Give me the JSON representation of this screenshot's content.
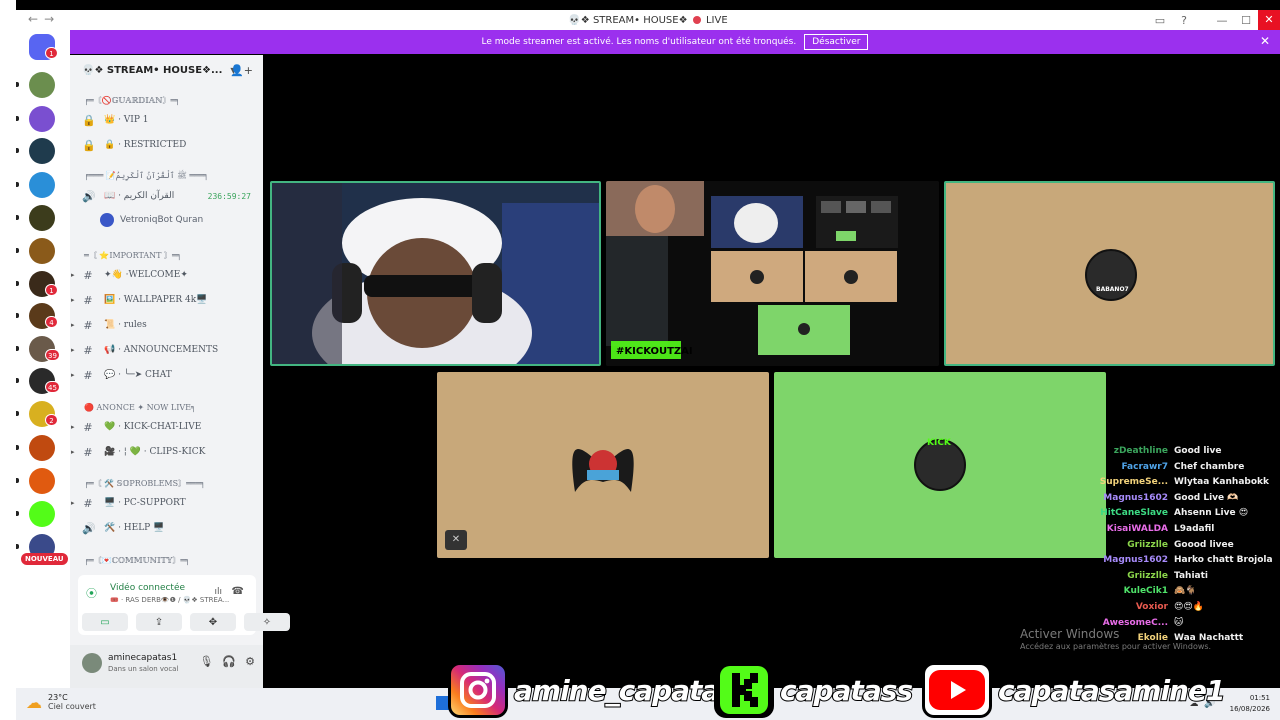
{
  "window": {
    "title_prefix": "💀❖ STREAM• HOUSE❖",
    "title_live": "LIVE",
    "nav_back": "←",
    "nav_forward": "→",
    "inbox_icon": "▭",
    "help_icon": "?",
    "minimize": "—",
    "maximize": "☐",
    "close": "✕"
  },
  "streamer_banner": {
    "text": "Le mode streamer est activé. Les noms d'utilisateur ont été tronqués.",
    "button": "Désactiver",
    "close": "✕"
  },
  "server_rail": {
    "items": [
      {
        "badge": "1",
        "color": "#5865f2"
      },
      {
        "badge": "",
        "color": "#6b8e4e"
      },
      {
        "badge": "",
        "color": "#7a4fd0"
      },
      {
        "badge": "",
        "color": "#1f3b4d"
      },
      {
        "badge": "",
        "color": "#2a8fd8"
      },
      {
        "badge": "",
        "color": "#3c3c1c"
      },
      {
        "badge": "",
        "color": "#8a5a1a"
      },
      {
        "badge": "1",
        "color": "#3a2a1a"
      },
      {
        "badge": "4",
        "color": "#5a3a1a"
      },
      {
        "badge": "39",
        "color": "#6a5a4a"
      },
      {
        "badge": "45",
        "color": "#2a2a2a"
      },
      {
        "badge": "2",
        "color": "#d8b020"
      },
      {
        "badge": "",
        "color": "#c04a10"
      },
      {
        "badge": "",
        "color": "#e05a10"
      },
      {
        "badge": "",
        "color": "#53fc18"
      },
      {
        "badge": "",
        "color": "#3a4a8a"
      }
    ],
    "nouveau": "NOUVEAU"
  },
  "sidebar": {
    "server_name": "💀❖ STREAM• HOUSE❖...",
    "channels": [
      {
        "type": "category",
        "label": "╒═〘🚫𝔾𝕌𝔸ℝ𝔻𝕀𝔸ℕ〙═╕"
      },
      {
        "type": "locked",
        "label": "👑 · VIP 1"
      },
      {
        "type": "locked",
        "label": "🔒 · RESTRICTED"
      },
      {
        "type": "category",
        "label": "╒═══ 📝ﷺ ٱلْقُرْآنُ ٱلْكَرِيمُ ═══╕"
      },
      {
        "type": "voice",
        "label": "📖 · القرآن الكريم",
        "timer": "236:59:27"
      },
      {
        "type": "category",
        "label": "═〘 ⭐IMPORTANT 〙═╕"
      },
      {
        "type": "text",
        "label": "✦👋 ·WELCOME✦"
      },
      {
        "type": "text",
        "label": "🖼️ · WALLPAPER 4k🖥️"
      },
      {
        "type": "text",
        "label": "📜 · rules"
      },
      {
        "type": "text",
        "label": "📢 · ANNOUNCEMENTS"
      },
      {
        "type": "text",
        "label": "💬 · ╰─➤ CHAT"
      },
      {
        "type": "category",
        "label": "🔴 ANONCE ✦ NOW LIVE╕"
      },
      {
        "type": "text",
        "label": "💚 · KICK-CHAT-LIVE"
      },
      {
        "type": "text",
        "label": "🎥 · ¦ 💚 · CLIPS-KICK"
      },
      {
        "type": "category",
        "label": "╒═〘 🛠️ 𝕊𝕆PROBLEMS〙═══╕"
      },
      {
        "type": "text",
        "label": "🖥️ · PC-SUPPORT"
      },
      {
        "type": "voice",
        "label": "🛠️ · HELP 🖥️"
      },
      {
        "type": "category",
        "label": "╒═〘💌ℂ𝕆𝕄𝕄𝕌ℕ𝕀𝕋𝕐〙═╕"
      }
    ],
    "voice_user": "VetroniqBot Quran"
  },
  "voice_panel": {
    "title": "Vidéo connectée",
    "subtitle": "🎟️ · RAS DERB👁️❶ / 💀❖ STREA...",
    "signal_icon": "⦿",
    "noise_icon": "ılı",
    "disconnect_icon": "☎",
    "buttons": [
      "▭",
      "⇪",
      "✥",
      "✧"
    ]
  },
  "user_panel": {
    "username": "aminecapatas1",
    "status": "Dans un salon vocal",
    "mic_icon": "🎙",
    "headset_icon": "🎧",
    "settings_icon": "⚙"
  },
  "stage": {
    "kick_badge": "#KICKOUTZAI",
    "avatar_label_1": "BABANO7",
    "avatar_label_2": "KICK",
    "muted_icon": "✕"
  },
  "chat": [
    {
      "user": "zDeathline",
      "msg": "Good live",
      "color": "#3ba55d"
    },
    {
      "user": "Facrawr7",
      "msg": "Chef chambre",
      "color": "#4fa3e8"
    },
    {
      "user": "SupremeSe...",
      "msg": "Wlytaa Kanhabokk",
      "color": "#f2d27b"
    },
    {
      "user": "Magnus1602",
      "msg": "Good Live 🫶🏻",
      "color": "#a78bfa"
    },
    {
      "user": "HitCaneSlave",
      "msg": "Ahsenn Live 😍",
      "color": "#3ddc84"
    },
    {
      "user": "KisaiWALDA",
      "msg": "L9adafil",
      "color": "#e86de8"
    },
    {
      "user": "Griizzlle",
      "msg": "Goood livee",
      "color": "#8bd64b"
    },
    {
      "user": "Magnus1602",
      "msg": "Harko chatt Brojola",
      "color": "#a78bfa"
    },
    {
      "user": "Griizzlle",
      "msg": "Tahiati",
      "color": "#8bd64b"
    },
    {
      "user": "KuleCik1",
      "msg": "🙈🐐",
      "color": "#4fe36a"
    },
    {
      "user": "Voxior",
      "msg": "😍😍🔥",
      "color": "#e85a4f"
    },
    {
      "user": "AwesomeC...",
      "msg": "🐱",
      "color": "#e86de8"
    },
    {
      "user": "Ekolie",
      "msg": "Waa Nachattt",
      "color": "#f2d27b"
    }
  ],
  "watermark": {
    "line1": "Activer Windows",
    "line2": "Accédez aux paramètres pour activer Windows."
  },
  "socials": [
    {
      "platform": "instagram",
      "handle": "amine_capatas",
      "color": "#d62976"
    },
    {
      "platform": "kick",
      "handle": "capatass",
      "color": "#53fc18"
    },
    {
      "platform": "youtube",
      "handle": "capatasamine1",
      "color": "#ff0000"
    }
  ],
  "taskbar": {
    "temp": "23°C",
    "weather": "Ciel couvert",
    "time": "01:51",
    "date": "16/08/2026",
    "tray_icons": [
      "⌃",
      "☁",
      "🔊"
    ]
  }
}
